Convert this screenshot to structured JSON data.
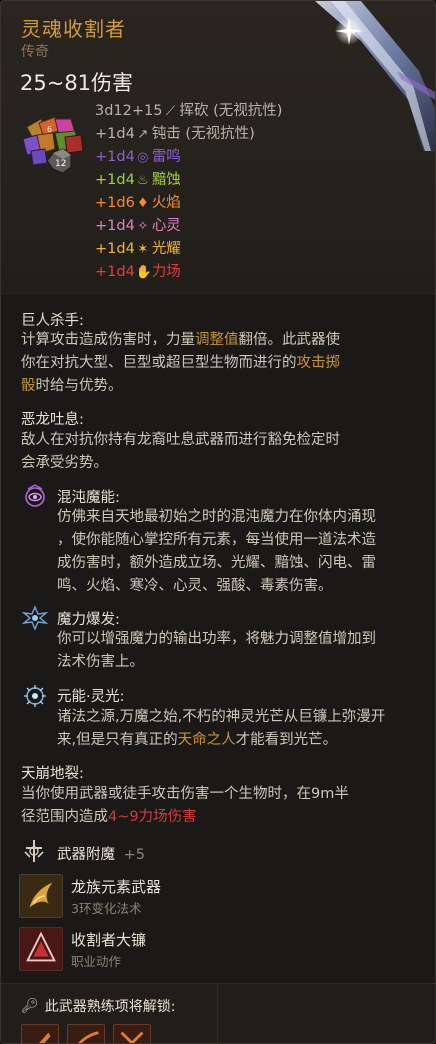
{
  "item": {
    "name": "灵魂收割者",
    "rarity": "传奇",
    "damage_total": "25~81伤害"
  },
  "damage_rows": [
    {
      "dice": "3d12+15",
      "icon": "slash-icon",
      "label": "挥砍 (无视抗性)",
      "color": "#b9b1a4"
    },
    {
      "dice": "+1d4",
      "icon": "bludgeon-icon",
      "label": "钝击 (无视抗性)",
      "color": "#b9b1a4"
    },
    {
      "dice": "+1d4",
      "icon": "thunder-icon",
      "label": "雷鸣",
      "color": "#8d5fcf"
    },
    {
      "dice": "+1d4",
      "icon": "acid-icon",
      "label": "黯蚀",
      "color": "#9ed33c"
    },
    {
      "dice": "+1d6",
      "icon": "fire-icon",
      "label": "火焰",
      "color": "#ff8a2a"
    },
    {
      "dice": "+1d4",
      "icon": "psychic-icon",
      "label": "心灵",
      "color": "#e080c2"
    },
    {
      "dice": "+1d4",
      "icon": "radiant-icon",
      "label": "光耀",
      "color": "#f3b52c"
    },
    {
      "dice": "+1d4",
      "icon": "force-icon",
      "label": "力场",
      "color": "#e23d3d"
    }
  ],
  "dice_badge": "12",
  "dice_small": "6",
  "sections": {
    "giant_slayer": {
      "title": "巨人杀手:",
      "line1": "计算攻击造成伤害时，力量",
      "line1_hl": "调整值",
      "line1_end": "翻倍。此武器使",
      "line2": "你在对抗大型、巨型或超巨型生物而进行的",
      "line2_hl": "攻击掷",
      "line3_hl": "骰",
      "line3": "时给与优势。"
    },
    "dragon_breath": {
      "title": "恶龙吐息:",
      "line1": "敌人在对抗你持有龙裔吐息武器而进行豁免检定时",
      "line2": "会承受劣势。"
    },
    "chaos_magic": {
      "title": "混沌魔能:",
      "lines": [
        "仿佛来自天地最初始之时的混沌魔力在你体内涌现",
        "，使你能随心掌控所有元素，每当使用一道法术造",
        "成伤害时，额外造成立场、光耀、黯蚀、闪电、雷",
        "鸣、火焰、寒冷、心灵、强酸、毒素伤害。"
      ]
    },
    "magic_burst": {
      "title": "魔力爆发:",
      "lines": [
        "你可以增强魔力的输出功率，将魅力调整值增加到",
        "法术伤害上。"
      ]
    },
    "elemental_light": {
      "title": "元能·灵光:",
      "line1": "诸法之源,万魔之始,不朽的神灵光芒从巨镰上弥漫开",
      "line2_a": "来,但是只有真正的",
      "line2_hl": "天命之人",
      "line2_b": "才能看到光芒。"
    },
    "earthquake": {
      "title": "天崩地裂:",
      "line1": "当你使用武器或徒手攻击伤害一个生物时，在9m半",
      "line2_a": "径范围内造成",
      "line2_red": "4~9力场伤害"
    },
    "enchant": {
      "label": "武器附魔",
      "value": "+5"
    }
  },
  "abilities": [
    {
      "name": "龙族元素武器",
      "sub": "3环变化法术",
      "icon": "dragon-weapon-icon"
    },
    {
      "name": "收割者大镰",
      "sub": "职业动作",
      "icon": "reaper-scythe-icon"
    }
  ],
  "footer": {
    "unlock_text": "此武器熟练项将解锁:"
  }
}
